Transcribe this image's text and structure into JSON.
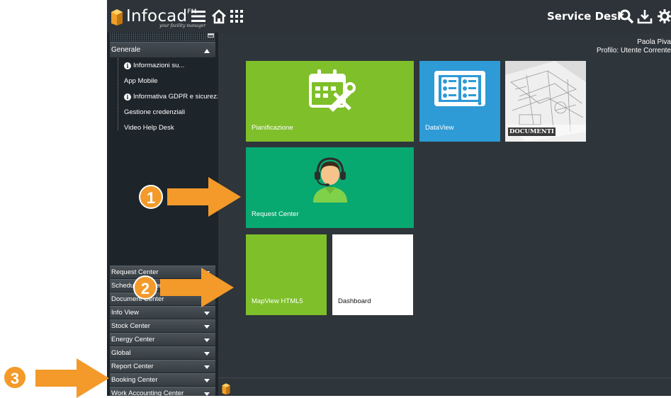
{
  "app": {
    "brand": "Infocad",
    "brand_sup": "FM",
    "tagline": "your facility manager",
    "title": "Service Desk"
  },
  "user": {
    "name": "Paola Piva",
    "profile": "Profilo: Utente Corrente"
  },
  "sidebar": {
    "general": {
      "header": "Generale",
      "items": [
        {
          "label": "Informazioni su...",
          "icon": "info-icon"
        },
        {
          "label": "App Mobile",
          "icon": ""
        },
        {
          "label": "Informativa GDPR e sicurezz",
          "icon": "info-icon"
        },
        {
          "label": "Gestione credenziali",
          "icon": ""
        },
        {
          "label": "Video Help Desk",
          "icon": ""
        }
      ]
    },
    "accordions": [
      "Request Center",
      "Schedule Center",
      "Document Center",
      "Info View",
      "Stock Center",
      "Energy Center",
      "Global",
      "Report Center",
      "Booking Center",
      "Work Accounting Center"
    ]
  },
  "tiles": {
    "pianificazione": {
      "label": "Pianificazione",
      "color": "#7fbf2a"
    },
    "dataview": {
      "label": "DataView",
      "color": "#2e9ad6"
    },
    "documenti": {
      "label": "DOCUMENTI"
    },
    "request_center": {
      "label": "Request Center",
      "color": "#08a871"
    },
    "mapview": {
      "label": "MapView HTML5",
      "color": "#7fbf2a"
    },
    "dashboard": {
      "label": "Dashboard",
      "color": "#ffffff"
    }
  },
  "callouts": [
    {
      "number": "1"
    },
    {
      "number": "2"
    },
    {
      "number": "3"
    }
  ],
  "colors": {
    "accent": "#f39a2a",
    "background": "#2e353b",
    "sidebar": "#1d242a"
  }
}
